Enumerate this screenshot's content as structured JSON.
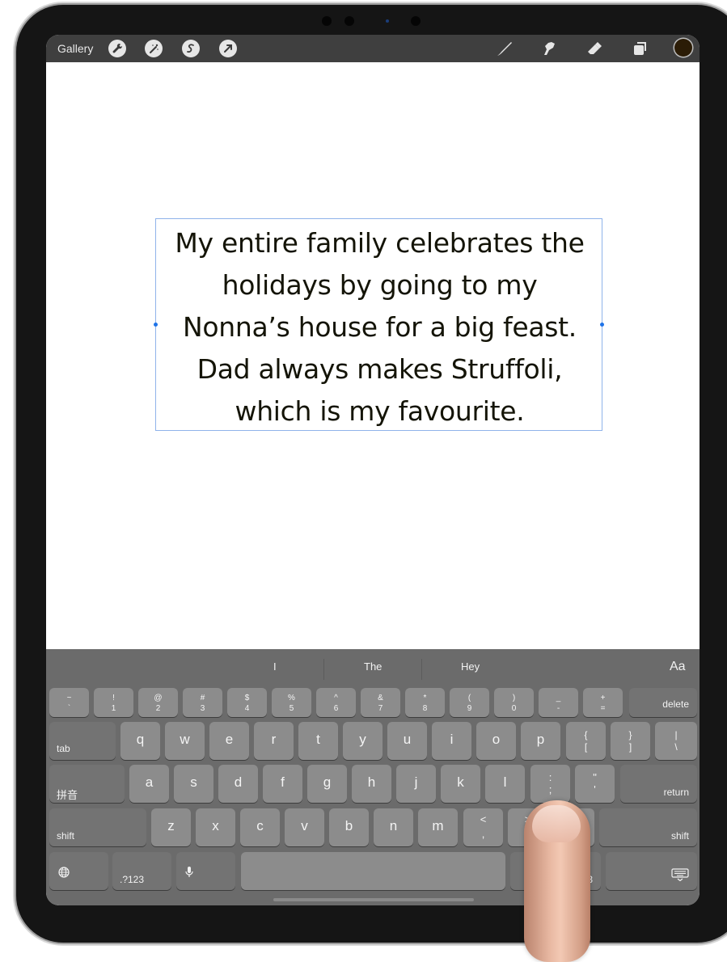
{
  "toolbar": {
    "gallery_label": "Gallery",
    "left_tools": [
      "wrench-icon",
      "magic-wand-icon",
      "selection-icon",
      "transform-arrow-icon"
    ],
    "right_tools": [
      "brush-icon",
      "smudge-icon",
      "eraser-icon",
      "layers-icon"
    ],
    "color_swatch": "#2b1c06"
  },
  "canvas": {
    "text_lines": [
      "My entire family celebrates the",
      "holidays by going to my",
      "Nonna’s house for a big feast.",
      "Dad always makes Struffoli,",
      "which is my favourite."
    ],
    "text_color": "#141407",
    "selection_color": "#1e73e8"
  },
  "keyboard": {
    "predictions": [
      "I",
      "The",
      "Hey"
    ],
    "format_label": "Aa",
    "row_numbers": [
      {
        "top": "~",
        "bottom": "`"
      },
      {
        "top": "!",
        "bottom": "1"
      },
      {
        "top": "@",
        "bottom": "2"
      },
      {
        "top": "#",
        "bottom": "3"
      },
      {
        "top": "$",
        "bottom": "4"
      },
      {
        "top": "%",
        "bottom": "5"
      },
      {
        "top": "^",
        "bottom": "6"
      },
      {
        "top": "&",
        "bottom": "7"
      },
      {
        "top": "*",
        "bottom": "8"
      },
      {
        "top": "(",
        "bottom": "9"
      },
      {
        "top": ")",
        "bottom": "0"
      },
      {
        "top": "_",
        "bottom": "-"
      },
      {
        "top": "+",
        "bottom": "="
      }
    ],
    "delete_label": "delete",
    "tab_label": "tab",
    "row_qwerty": [
      "q",
      "w",
      "e",
      "r",
      "t",
      "y",
      "u",
      "i",
      "o",
      "p"
    ],
    "row_qwerty_symbols": [
      {
        "top": "{",
        "bottom": "["
      },
      {
        "top": "}",
        "bottom": "]"
      },
      {
        "top": "|",
        "bottom": "\\"
      }
    ],
    "pinyin_label": "拼音",
    "row_home": [
      "a",
      "s",
      "d",
      "f",
      "g",
      "h",
      "j",
      "k",
      "l"
    ],
    "row_home_symbols": [
      {
        "top": ":",
        "bottom": ";"
      },
      {
        "top": "\"",
        "bottom": "'"
      }
    ],
    "return_label": "return",
    "shift_label": "shift",
    "row_bottom": [
      "z",
      "x",
      "c",
      "v",
      "b",
      "n",
      "m"
    ],
    "row_bottom_symbols": [
      {
        "top": "<",
        "bottom": ","
      },
      {
        "top": ">",
        "bottom": "."
      },
      {
        "top": "?",
        "bottom": "/"
      }
    ],
    "numbers_label": ".?123",
    "numbers_label_right_visible": "3",
    "globe_icon": "globe-icon",
    "mic_icon": "microphone-icon",
    "hide_keyboard_icon": "keyboard-dismiss-icon"
  }
}
